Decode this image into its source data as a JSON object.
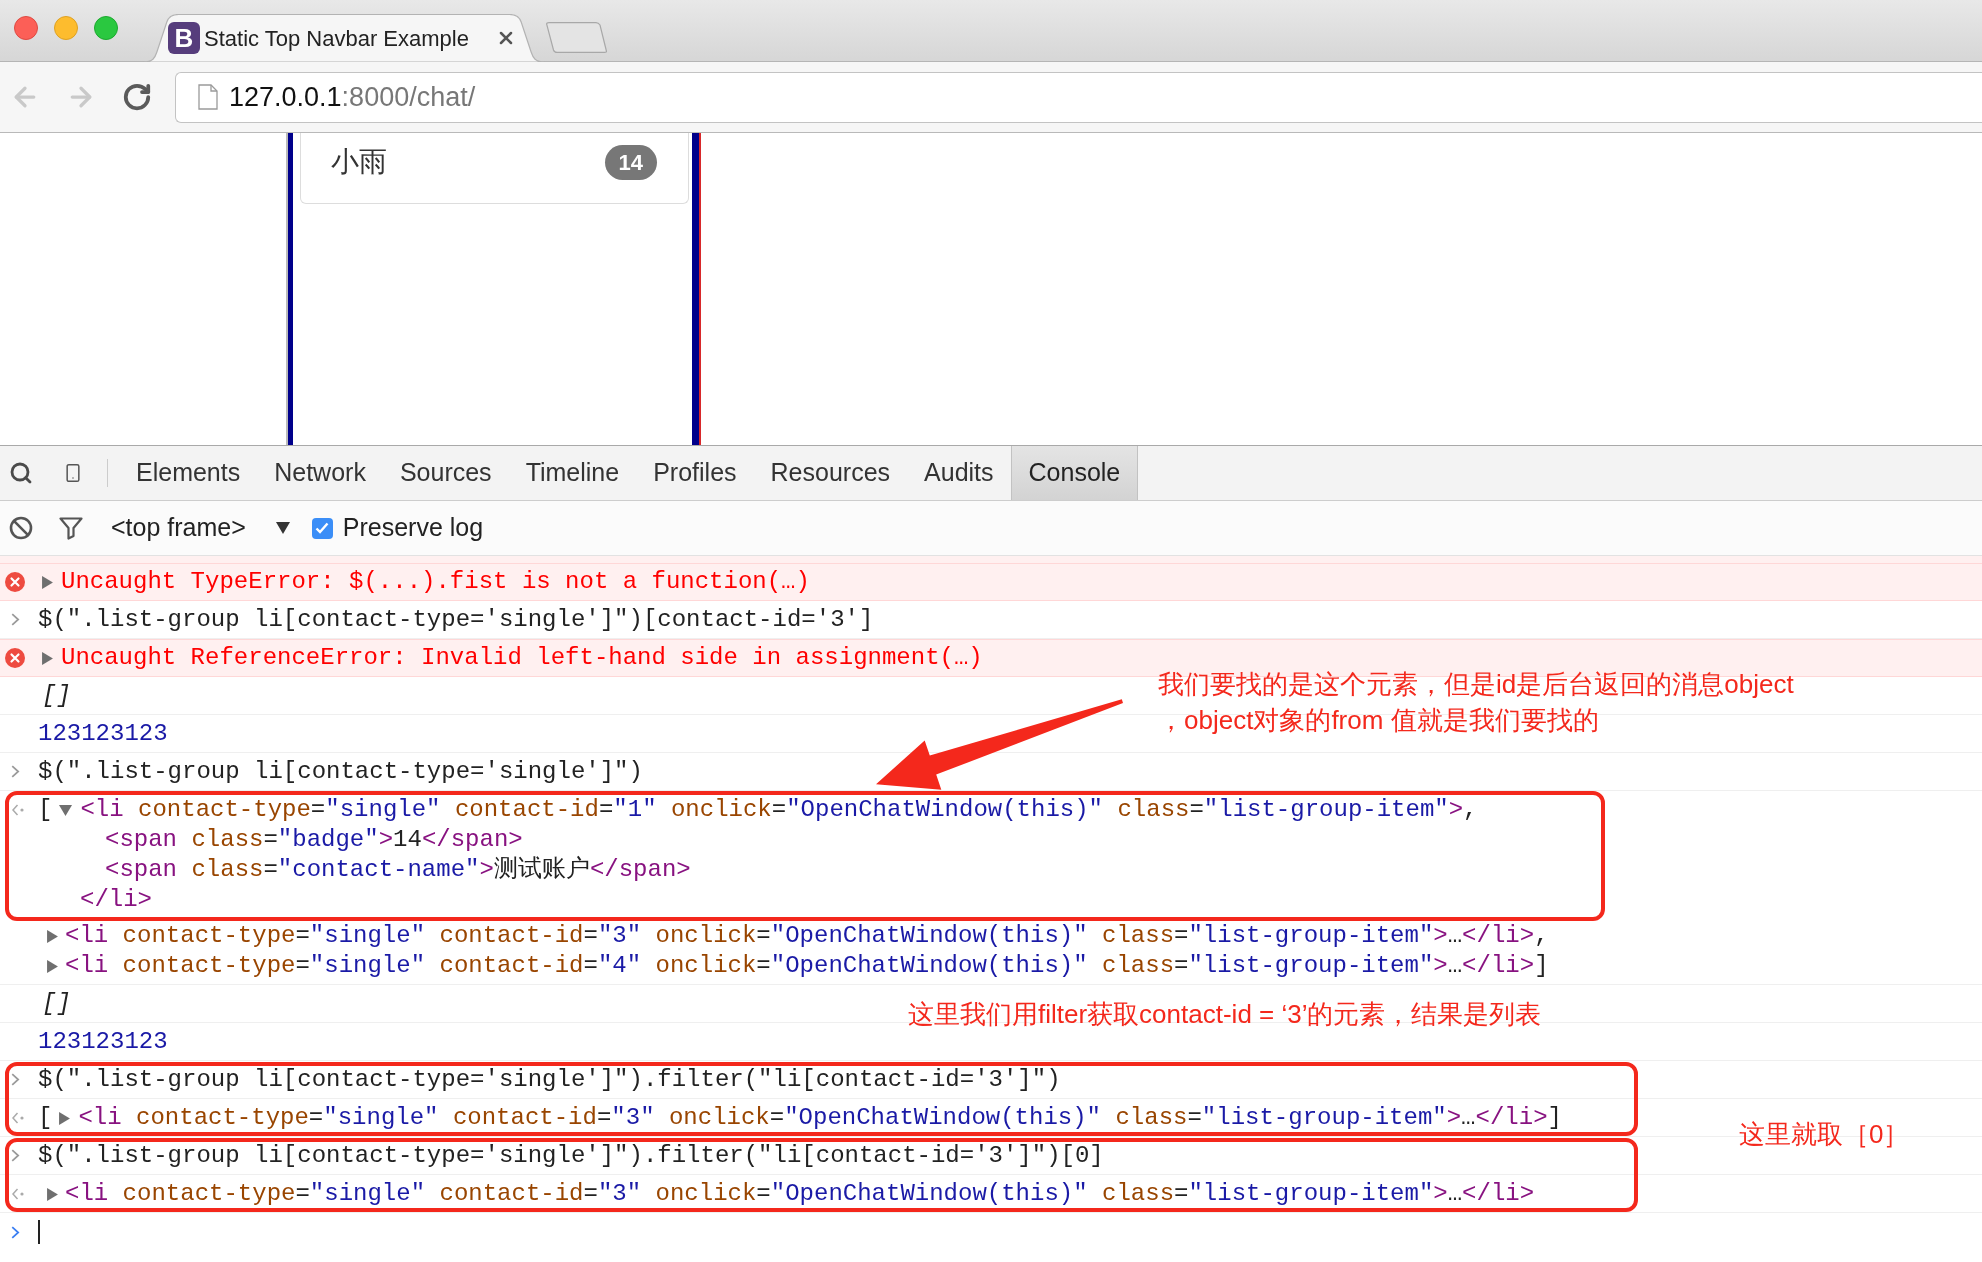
{
  "browser": {
    "tabs": [
      {
        "favicon_letter": "B",
        "title": "Static Top Navbar Example",
        "selected": true
      }
    ],
    "nav_buttons": [
      {
        "kind": "back",
        "disabled": true
      },
      {
        "kind": "forward",
        "disabled": true
      },
      {
        "kind": "reload",
        "disabled": false
      }
    ],
    "address": {
      "host": "127.0.0.1",
      "rest": ":8000/chat/"
    }
  },
  "page": {
    "contacts": [
      {
        "name": "小雨",
        "badge": "14"
      }
    ]
  },
  "devtools": {
    "tabs": [
      {
        "label": "Elements",
        "selected": false
      },
      {
        "label": "Network",
        "selected": false
      },
      {
        "label": "Sources",
        "selected": false
      },
      {
        "label": "Timeline",
        "selected": false
      },
      {
        "label": "Profiles",
        "selected": false
      },
      {
        "label": "Resources",
        "selected": false
      },
      {
        "label": "Audits",
        "selected": false
      },
      {
        "label": "Console",
        "selected": true
      }
    ],
    "toolbar": {
      "context": "<top frame>",
      "preserve_log": {
        "label": "Preserve log",
        "checked": true
      }
    },
    "console": [
      {
        "lines": [
          {
            "kind": "error",
            "expanded": false,
            "text": "Uncaught TypeError: $(...).fist is not a function(…)"
          },
          {
            "kind": "input",
            "text": "$(\".list-group li[contact-type='single']\")[contact-id='3']"
          },
          {
            "kind": "error",
            "expanded": false,
            "text": "Uncaught ReferenceError: Invalid left-hand side in assignment(…)"
          },
          {
            "kind": "array",
            "text": "[]"
          },
          {
            "kind": "number",
            "text": "123123123"
          },
          {
            "kind": "input",
            "text": "$(\".list-group li[contact-type='single']\")"
          },
          {
            "kind": "result",
            "bracket": "[",
            "nodes": [
              {
                "expanded": true,
                "boxed": true,
                "segments": [
                  {
                    "kind": "tag",
                    "text": "<li"
                  },
                  {
                    "kind": "attr",
                    "text": " contact-type"
                  },
                  {
                    "kind": "plain",
                    "text": "="
                  },
                  {
                    "kind": "value",
                    "text": "\"single\""
                  },
                  {
                    "kind": "attr",
                    "text": " contact-id"
                  },
                  {
                    "kind": "plain",
                    "text": "="
                  },
                  {
                    "kind": "value",
                    "text": "\"1\""
                  },
                  {
                    "kind": "attr",
                    "text": " onclick"
                  },
                  {
                    "kind": "plain",
                    "text": "="
                  },
                  {
                    "kind": "value",
                    "text": "\"OpenChatWindow(this)\""
                  },
                  {
                    "kind": "attr",
                    "text": " class"
                  },
                  {
                    "kind": "plain",
                    "text": "="
                  },
                  {
                    "kind": "value",
                    "text": "\"list-group-item\""
                  },
                  {
                    "kind": "tag",
                    "text": ">"
                  },
                  {
                    "kind": "plain",
                    "text": ","
                  }
                ],
                "children": [
                  {
                    "segments": [
                      {
                        "kind": "tag",
                        "text": "<span"
                      },
                      {
                        "kind": "attr",
                        "text": " class"
                      },
                      {
                        "kind": "plain",
                        "text": "="
                      },
                      {
                        "kind": "value",
                        "text": "\"badge\""
                      },
                      {
                        "kind": "tag",
                        "text": ">"
                      },
                      {
                        "kind": "plain",
                        "text": "14"
                      },
                      {
                        "kind": "tag",
                        "text": "</span>"
                      }
                    ]
                  },
                  {
                    "segments": [
                      {
                        "kind": "tag",
                        "text": "<span"
                      },
                      {
                        "kind": "attr",
                        "text": " class"
                      },
                      {
                        "kind": "plain",
                        "text": "="
                      },
                      {
                        "kind": "value",
                        "text": "\"contact-name\""
                      },
                      {
                        "kind": "tag",
                        "text": ">"
                      },
                      {
                        "kind": "plain",
                        "text": "测试账户"
                      },
                      {
                        "kind": "tag",
                        "text": "</span>"
                      }
                    ]
                  }
                ],
                "closing": [
                  {
                    "kind": "tag",
                    "text": "</li>"
                  }
                ]
              },
              {
                "expanded": false,
                "segments": [
                  {
                    "kind": "tag",
                    "text": "<li"
                  },
                  {
                    "kind": "attr",
                    "text": " contact-type"
                  },
                  {
                    "kind": "plain",
                    "text": "="
                  },
                  {
                    "kind": "value",
                    "text": "\"single\""
                  },
                  {
                    "kind": "attr",
                    "text": " contact-id"
                  },
                  {
                    "kind": "plain",
                    "text": "="
                  },
                  {
                    "kind": "value",
                    "text": "\"3\""
                  },
                  {
                    "kind": "attr",
                    "text": " onclick"
                  },
                  {
                    "kind": "plain",
                    "text": "="
                  },
                  {
                    "kind": "value",
                    "text": "\"OpenChatWindow(this)\""
                  },
                  {
                    "kind": "attr",
                    "text": " class"
                  },
                  {
                    "kind": "plain",
                    "text": "="
                  },
                  {
                    "kind": "value",
                    "text": "\"list-group-item\""
                  },
                  {
                    "kind": "tag",
                    "text": ">"
                  },
                  {
                    "kind": "plain",
                    "text": "…"
                  },
                  {
                    "kind": "tag",
                    "text": "</li>"
                  },
                  {
                    "kind": "plain",
                    "text": ","
                  }
                ]
              },
              {
                "expanded": false,
                "segments": [
                  {
                    "kind": "tag",
                    "text": "<li"
                  },
                  {
                    "kind": "attr",
                    "text": " contact-type"
                  },
                  {
                    "kind": "plain",
                    "text": "="
                  },
                  {
                    "kind": "value",
                    "text": "\"single\""
                  },
                  {
                    "kind": "attr",
                    "text": " contact-id"
                  },
                  {
                    "kind": "plain",
                    "text": "="
                  },
                  {
                    "kind": "value",
                    "text": "\"4\""
                  },
                  {
                    "kind": "attr",
                    "text": " onclick"
                  },
                  {
                    "kind": "plain",
                    "text": "="
                  },
                  {
                    "kind": "value",
                    "text": "\"OpenChatWindow(this)\""
                  },
                  {
                    "kind": "attr",
                    "text": " class"
                  },
                  {
                    "kind": "plain",
                    "text": "="
                  },
                  {
                    "kind": "value",
                    "text": "\"list-group-item\""
                  },
                  {
                    "kind": "tag",
                    "text": ">"
                  },
                  {
                    "kind": "plain",
                    "text": "…"
                  },
                  {
                    "kind": "tag",
                    "text": "</li>"
                  },
                  {
                    "kind": "plain",
                    "text": "]"
                  }
                ]
              }
            ]
          },
          {
            "kind": "array",
            "text": "[]"
          },
          {
            "kind": "number",
            "text": "123123123"
          }
        ]
      },
      {
        "boxed": true,
        "lines": [
          {
            "kind": "input",
            "text": "$(\".list-group li[contact-type='single']\").filter(\"li[contact-id='3']\")"
          },
          {
            "kind": "result",
            "bracket": "[",
            "nodes": [
              {
                "expanded": false,
                "segments": [
                  {
                    "kind": "tag",
                    "text": "<li"
                  },
                  {
                    "kind": "attr",
                    "text": " contact-type"
                  },
                  {
                    "kind": "plain",
                    "text": "="
                  },
                  {
                    "kind": "value",
                    "text": "\"single\""
                  },
                  {
                    "kind": "attr",
                    "text": " contact-id"
                  },
                  {
                    "kind": "plain",
                    "text": "="
                  },
                  {
                    "kind": "value",
                    "text": "\"3\""
                  },
                  {
                    "kind": "attr",
                    "text": " onclick"
                  },
                  {
                    "kind": "plain",
                    "text": "="
                  },
                  {
                    "kind": "value",
                    "text": "\"OpenChatWindow(this)\""
                  },
                  {
                    "kind": "attr",
                    "text": " class"
                  },
                  {
                    "kind": "plain",
                    "text": "="
                  },
                  {
                    "kind": "value",
                    "text": "\"list-group-item\""
                  },
                  {
                    "kind": "tag",
                    "text": ">"
                  },
                  {
                    "kind": "plain",
                    "text": "…"
                  },
                  {
                    "kind": "tag",
                    "text": "</li>"
                  },
                  {
                    "kind": "plain",
                    "text": "]"
                  }
                ]
              }
            ]
          }
        ]
      },
      {
        "boxed": true,
        "lines": [
          {
            "kind": "input",
            "text": "$(\".list-group li[contact-type='single']\").filter(\"li[contact-id='3']\")[0]"
          },
          {
            "kind": "result",
            "nodes": [
              {
                "expanded": false,
                "segments": [
                  {
                    "kind": "tag",
                    "text": "<li"
                  },
                  {
                    "kind": "attr",
                    "text": " contact-type"
                  },
                  {
                    "kind": "plain",
                    "text": "="
                  },
                  {
                    "kind": "value",
                    "text": "\"single\""
                  },
                  {
                    "kind": "attr",
                    "text": " contact-id"
                  },
                  {
                    "kind": "plain",
                    "text": "="
                  },
                  {
                    "kind": "value",
                    "text": "\"3\""
                  },
                  {
                    "kind": "attr",
                    "text": " onclick"
                  },
                  {
                    "kind": "plain",
                    "text": "="
                  },
                  {
                    "kind": "value",
                    "text": "\"OpenChatWindow(this)\""
                  },
                  {
                    "kind": "attr",
                    "text": " class"
                  },
                  {
                    "kind": "plain",
                    "text": "="
                  },
                  {
                    "kind": "value",
                    "text": "\"list-group-item\""
                  },
                  {
                    "kind": "tag",
                    "text": ">"
                  },
                  {
                    "kind": "plain",
                    "text": "…"
                  },
                  {
                    "kind": "tag",
                    "text": "</li>"
                  }
                ]
              }
            ]
          }
        ]
      },
      {
        "lines": [
          {
            "kind": "prompt"
          }
        ]
      }
    ]
  },
  "annotations": {
    "notes": [
      {
        "lines": [
          "我们要找的是这个元素，但是id是后台返回的消息object",
          "，object对象的from 值就是我们要找的"
        ]
      },
      {
        "lines": [
          "这里我们用filter获取contact-id = ‘3’的元素，结果是列表"
        ]
      },
      {
        "lines": [
          "这里就取［0］"
        ]
      }
    ]
  }
}
